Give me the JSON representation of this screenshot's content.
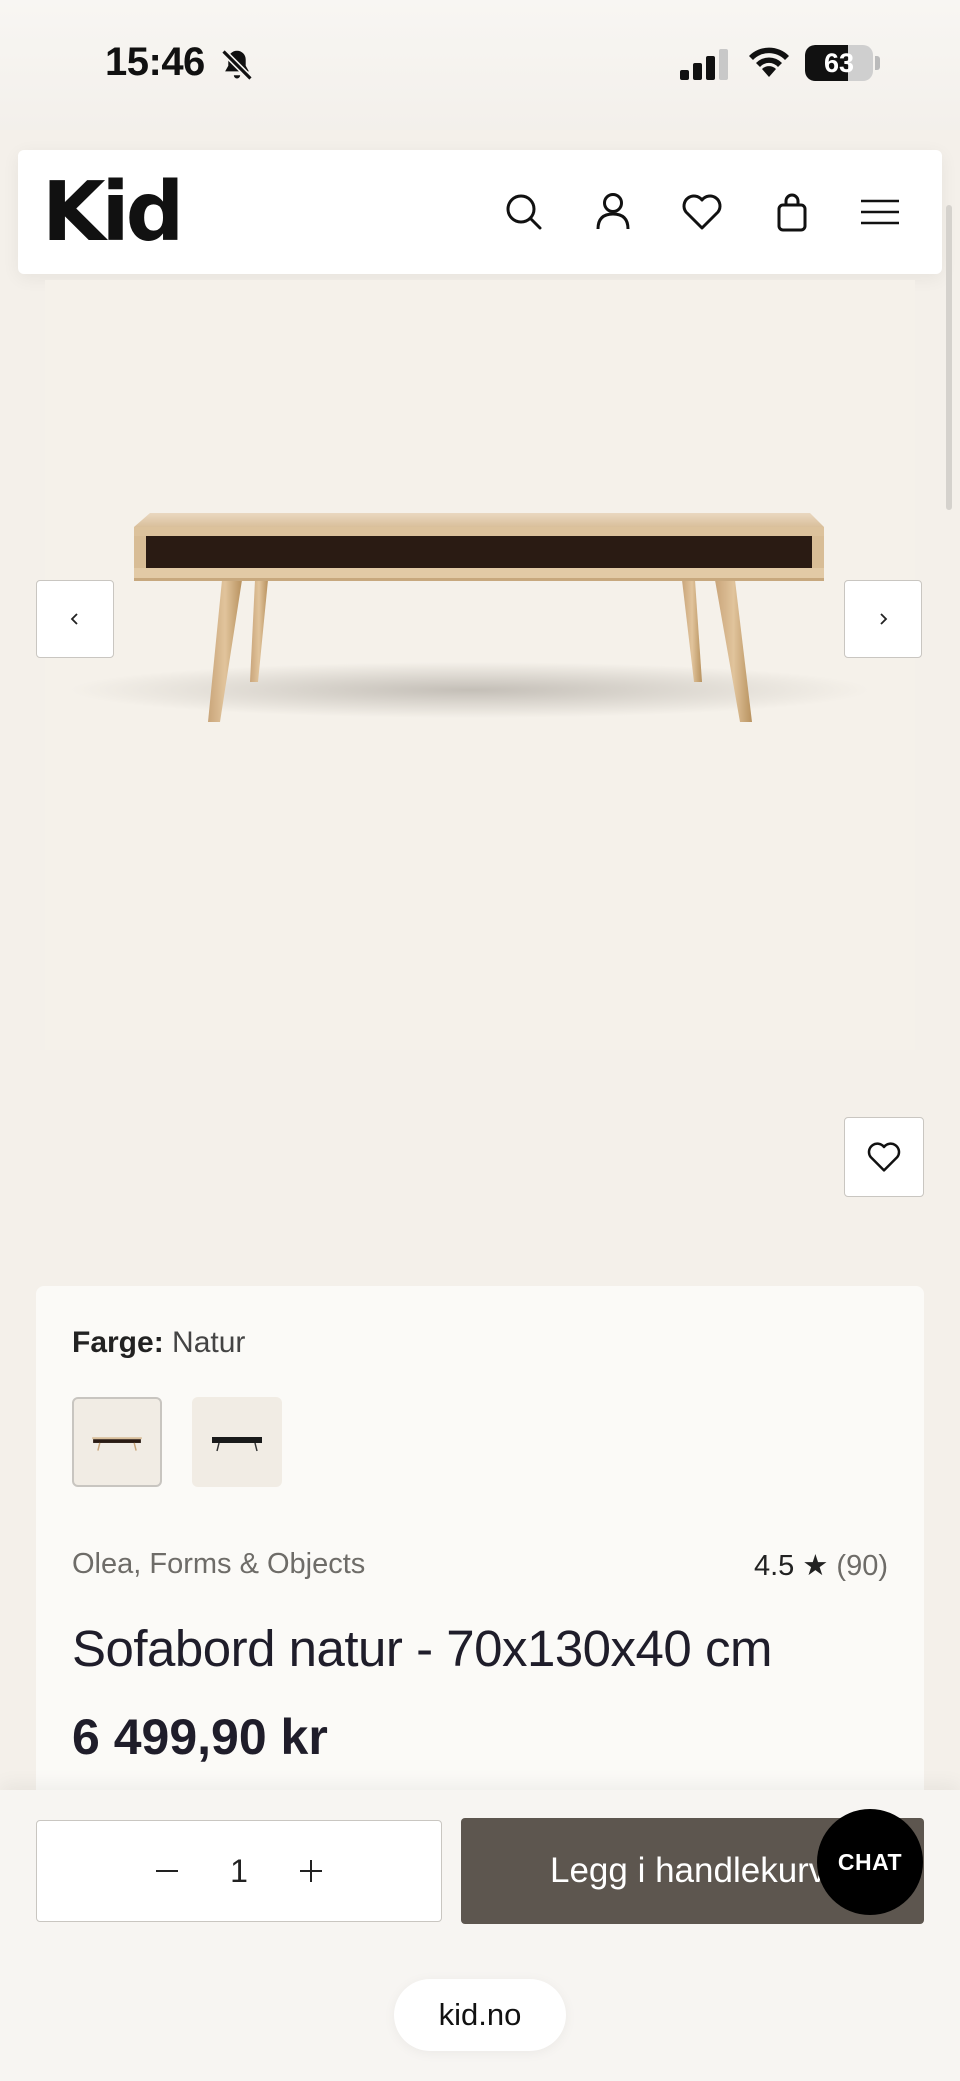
{
  "status_bar": {
    "time": "15:46",
    "battery_percent": 63,
    "battery_label": "63",
    "icons": [
      "bell-slash-icon",
      "cellular-signal-icon",
      "wifi-icon",
      "battery-icon"
    ]
  },
  "header": {
    "logo": "Kid",
    "icons": [
      "search-icon",
      "account-icon",
      "heart-icon",
      "shopping-bag-icon",
      "menu-icon"
    ]
  },
  "gallery": {
    "prev_icon": "chevron-left-icon",
    "next_icon": "chevron-right-icon",
    "favorite_icon": "heart-icon"
  },
  "product": {
    "color_label": "Farge:",
    "color_value": "Natur",
    "swatches": [
      {
        "name": "natur",
        "selected": true
      },
      {
        "name": "dark",
        "selected": false
      }
    ],
    "brand": "Olea, Forms & Objects",
    "rating": "4.5",
    "rating_count": "(90)",
    "title": "Sofabord natur - 70x130x40 cm",
    "price": "6 499,90 kr"
  },
  "purchase": {
    "quantity": "1",
    "add_to_cart_label": "Legg i handlekurv",
    "chat_label": "CHAT"
  },
  "browser": {
    "url": "kid.no"
  },
  "colors": {
    "page_bg": "#f4f0ea",
    "button_dark": "#5d564f",
    "text_dark": "#1f1d2a"
  }
}
